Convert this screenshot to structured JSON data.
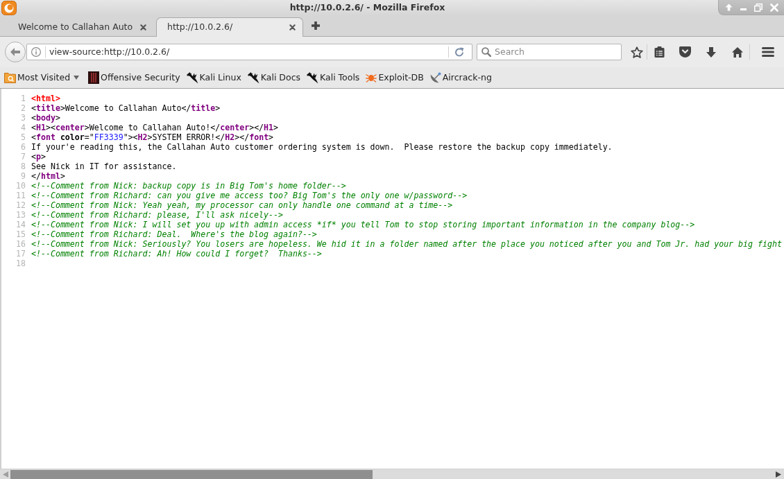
{
  "window": {
    "title": "http://10.0.2.6/ - Mozilla Firefox"
  },
  "tabs": [
    {
      "label": "Welcome to Callahan Auto",
      "selected": false
    },
    {
      "label": "http://10.0.2.6/",
      "selected": true
    }
  ],
  "address_bar": {
    "value": "view-source:http://10.0.2.6/"
  },
  "search": {
    "placeholder": "Search"
  },
  "bookmarks": [
    {
      "label": "Most Visited",
      "kind": "folder"
    },
    {
      "label": "Offensive Security",
      "kind": "link"
    },
    {
      "label": "Kali Linux",
      "kind": "link"
    },
    {
      "label": "Kali Docs",
      "kind": "link"
    },
    {
      "label": "Kali Tools",
      "kind": "link"
    },
    {
      "label": "Exploit-DB",
      "kind": "link"
    },
    {
      "label": "Aircrack-ng",
      "kind": "link"
    }
  ],
  "source_lines": [
    {
      "number": "1",
      "tokens": [
        {
          "kind": "error",
          "text": "<html>"
        }
      ]
    },
    {
      "number": "2",
      "tokens": [
        {
          "kind": "text",
          "text": "<"
        },
        {
          "kind": "tag",
          "text": "title"
        },
        {
          "kind": "text",
          "text": ">Welcome to Callahan Auto</"
        },
        {
          "kind": "tag",
          "text": "title"
        },
        {
          "kind": "text",
          "text": ">"
        }
      ]
    },
    {
      "number": "3",
      "tokens": [
        {
          "kind": "text",
          "text": "<"
        },
        {
          "kind": "tag",
          "text": "body"
        },
        {
          "kind": "text",
          "text": ">"
        }
      ]
    },
    {
      "number": "4",
      "tokens": [
        {
          "kind": "text",
          "text": "<"
        },
        {
          "kind": "tag",
          "text": "H1"
        },
        {
          "kind": "text",
          "text": "><"
        },
        {
          "kind": "tag",
          "text": "center"
        },
        {
          "kind": "text",
          "text": ">Welcome to Callahan Auto!</"
        },
        {
          "kind": "tag",
          "text": "center"
        },
        {
          "kind": "text",
          "text": "></"
        },
        {
          "kind": "tag",
          "text": "H1"
        },
        {
          "kind": "text",
          "text": ">"
        }
      ]
    },
    {
      "number": "5",
      "tokens": [
        {
          "kind": "text",
          "text": "<"
        },
        {
          "kind": "tag",
          "text": "font"
        },
        {
          "kind": "attribute",
          "text": " color"
        },
        {
          "kind": "text",
          "text": "=\""
        },
        {
          "kind": "value",
          "text": "FF3339"
        },
        {
          "kind": "text",
          "text": "\"><"
        },
        {
          "kind": "tag",
          "text": "H2"
        },
        {
          "kind": "text",
          "text": ">SYSTEM ERROR!</"
        },
        {
          "kind": "tag",
          "text": "H2"
        },
        {
          "kind": "text",
          "text": "></"
        },
        {
          "kind": "tag",
          "text": "font"
        },
        {
          "kind": "text",
          "text": ">"
        }
      ]
    },
    {
      "number": "6",
      "tokens": [
        {
          "kind": "text",
          "text": "If your'e reading this, the Callahan Auto customer ordering system is down.  Please restore the backup copy immediately."
        }
      ]
    },
    {
      "number": "7",
      "tokens": [
        {
          "kind": "text",
          "text": "<"
        },
        {
          "kind": "tag",
          "text": "p"
        },
        {
          "kind": "text",
          "text": ">"
        }
      ]
    },
    {
      "number": "8",
      "tokens": [
        {
          "kind": "text",
          "text": "See Nick in IT for assistance."
        }
      ]
    },
    {
      "number": "9",
      "tokens": [
        {
          "kind": "text",
          "text": "</"
        },
        {
          "kind": "tag",
          "text": "html"
        },
        {
          "kind": "text",
          "text": ">"
        }
      ]
    },
    {
      "number": "10",
      "tokens": [
        {
          "kind": "comment",
          "text": "<!--Comment from Nick: backup copy is in Big Tom's home folder-->"
        }
      ]
    },
    {
      "number": "11",
      "tokens": [
        {
          "kind": "comment",
          "text": "<!--Comment from Richard: can you give me access too? Big Tom's the only one w/password-->"
        }
      ]
    },
    {
      "number": "12",
      "tokens": [
        {
          "kind": "comment",
          "text": "<!--Comment from Nick: Yeah yeah, my processor can only handle one command at a time-->"
        }
      ]
    },
    {
      "number": "13",
      "tokens": [
        {
          "kind": "comment",
          "text": "<!--Comment from Richard: please, I'll ask nicely-->"
        }
      ]
    },
    {
      "number": "14",
      "tokens": [
        {
          "kind": "comment",
          "text": "<!--Comment from Nick: I will set you up with admin access *if* you tell Tom to stop storing important information in the company blog-->"
        }
      ]
    },
    {
      "number": "15",
      "tokens": [
        {
          "kind": "comment",
          "text": "<!--Comment from Richard: Deal.  Where's the blog again?-->"
        }
      ]
    },
    {
      "number": "16",
      "tokens": [
        {
          "kind": "comment",
          "text": "<!--Comment from Nick: Seriously? You losers are hopeless. We hid it in a folder named after the place you noticed after you and Tom Jr. had your big fight"
        }
      ]
    },
    {
      "number": "17",
      "tokens": [
        {
          "kind": "comment",
          "text": "<!--Comment from Richard: Ah! How could I forget?  Thanks-->"
        }
      ]
    },
    {
      "number": "18"
    }
  ]
}
